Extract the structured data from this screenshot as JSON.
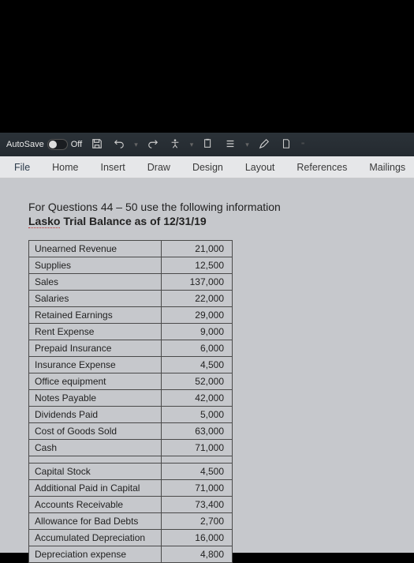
{
  "titleBar": {
    "autosaveLabel": "AutoSave",
    "autosaveState": "Off"
  },
  "ribbon": {
    "tabs": [
      "File",
      "Home",
      "Insert",
      "Draw",
      "Design",
      "Layout",
      "References",
      "Mailings"
    ]
  },
  "document": {
    "instruction": "For Questions 44 – 50 use the following information",
    "subtitlePrefix": "Lasko",
    "subtitleRest": " Trial Balance as of 12/31/19",
    "rowsA": [
      {
        "label": "Unearned Revenue",
        "value": "21,000"
      },
      {
        "label": "Supplies",
        "value": "12,500"
      },
      {
        "label": "Sales",
        "value": "137,000"
      },
      {
        "label": "Salaries",
        "value": "22,000"
      },
      {
        "label": "Retained Earnings",
        "value": "29,000"
      },
      {
        "label": "Rent Expense",
        "value": "9,000"
      },
      {
        "label": "Prepaid Insurance",
        "value": "6,000"
      },
      {
        "label": "Insurance Expense",
        "value": "4,500"
      },
      {
        "label": "Office equipment",
        "value": "52,000"
      },
      {
        "label": "Notes Payable",
        "value": "42,000"
      },
      {
        "label": "Dividends Paid",
        "value": "5,000"
      },
      {
        "label": "Cost of Goods Sold",
        "value": "63,000"
      },
      {
        "label": "Cash",
        "value": "71,000"
      }
    ],
    "rowsB": [
      {
        "label": "Capital Stock",
        "value": "4,500"
      },
      {
        "label": "Additional Paid in Capital",
        "value": "71,000"
      },
      {
        "label": "Accounts Receivable",
        "value": "73,400"
      },
      {
        "label": "Allowance for Bad Debts",
        "value": "2,700"
      },
      {
        "label": "Accumulated Depreciation",
        "value": "16,000"
      },
      {
        "label": "Depreciation expense",
        "value": "4,800"
      }
    ]
  }
}
